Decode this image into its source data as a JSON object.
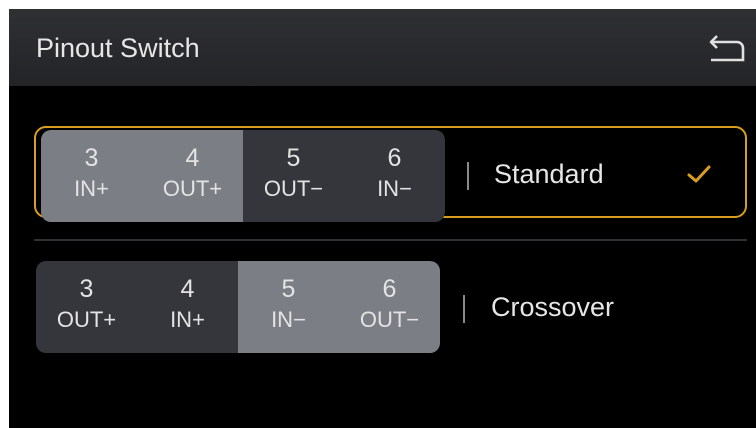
{
  "header": {
    "title": "Pinout Switch",
    "back_icon": "back-arrow-icon"
  },
  "options": [
    {
      "name": "Standard",
      "selected": true,
      "pins": [
        {
          "num": "3",
          "label": "IN+"
        },
        {
          "num": "4",
          "label": "OUT+"
        },
        {
          "num": "5",
          "label": "OUT−"
        },
        {
          "num": "6",
          "label": "IN−"
        }
      ]
    },
    {
      "name": "Crossover",
      "selected": false,
      "pins": [
        {
          "num": "3",
          "label": "OUT+"
        },
        {
          "num": "4",
          "label": "IN+"
        },
        {
          "num": "5",
          "label": "IN−"
        },
        {
          "num": "6",
          "label": "OUT−"
        }
      ]
    }
  ],
  "colors": {
    "accent": "#d99d22",
    "segment_light": "#7b7e85",
    "segment_dark": "#34363b",
    "background": "#000000"
  }
}
